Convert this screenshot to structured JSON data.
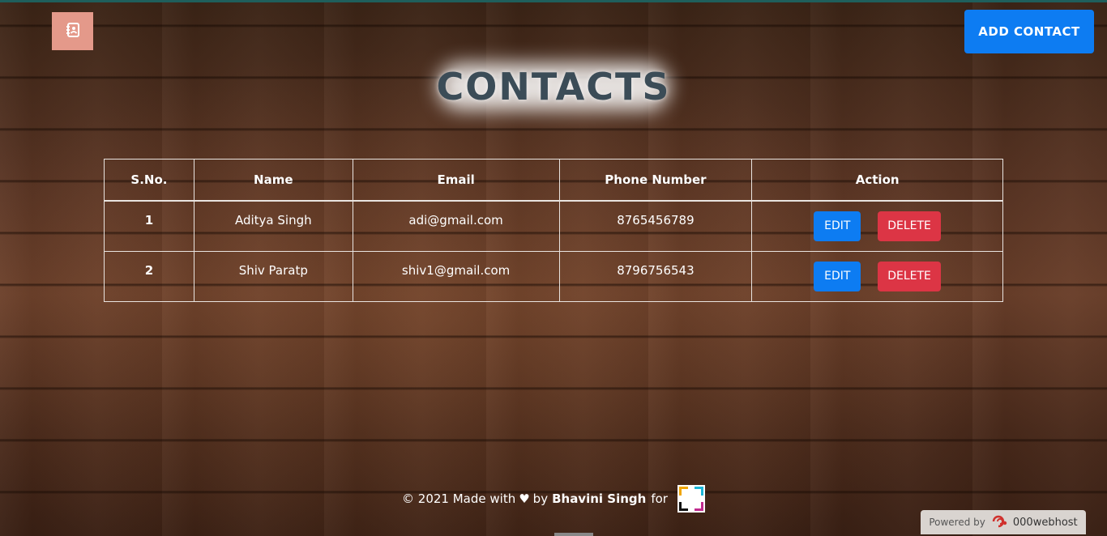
{
  "header": {
    "logo_icon": "address-book-icon",
    "add_button_label": "ADD CONTACT",
    "page_title": "CONTACTS"
  },
  "table": {
    "columns": [
      "S.No.",
      "Name",
      "Email",
      "Phone Number",
      "Action"
    ],
    "rows": [
      {
        "sno": "1",
        "name": "Aditya Singh",
        "email": "adi@gmail.com",
        "phone": "8765456789"
      },
      {
        "sno": "2",
        "name": "Shiv Paratp",
        "email": "shiv1@gmail.com",
        "phone": "8796756543"
      }
    ],
    "edit_label": "EDIT",
    "delete_label": "DELETE"
  },
  "footer": {
    "prefix": "© 2021 Made with",
    "heart": "♥",
    "by": "by",
    "author": "Bhavini Singh",
    "for": "for"
  },
  "badge": {
    "powered_by": "Powered by",
    "brand": "000webhost"
  },
  "colors": {
    "primary": "#0d7cf2",
    "danger": "#dc3545",
    "logo_bg": "#e4998a",
    "title": "#3b4c57"
  }
}
